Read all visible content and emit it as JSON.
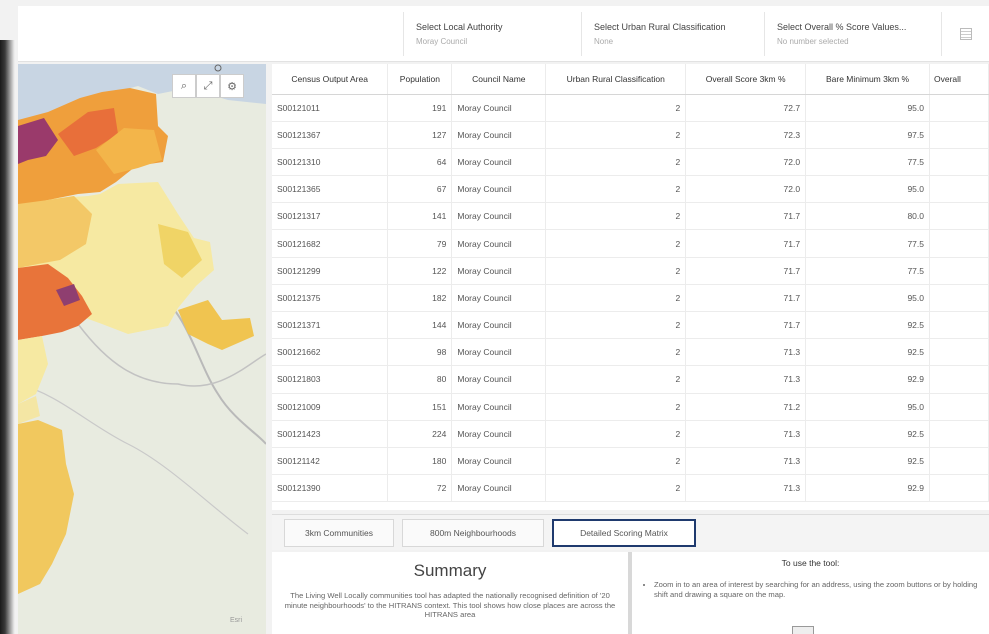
{
  "filters": [
    {
      "label": "Select Local Authority",
      "value": "Moray Council"
    },
    {
      "label": "Select Urban Rural Classification",
      "value": "None"
    },
    {
      "label": "Select Overall % Score Values...",
      "value": "No number selected"
    }
  ],
  "map": {
    "tools": [
      "search-icon",
      "expand-icon",
      "settings-icon"
    ],
    "attribution": "Esri"
  },
  "table": {
    "columns": [
      "Census Output Area",
      "Population",
      "Council Name",
      "Urban Rural Classification",
      "Overall Score 3km %",
      "Bare Minimum 3km %",
      "Overall"
    ],
    "rows": [
      [
        "S00121011",
        "191",
        "Moray Council",
        "2",
        "72.7",
        "95.0",
        ""
      ],
      [
        "S00121367",
        "127",
        "Moray Council",
        "2",
        "72.3",
        "97.5",
        ""
      ],
      [
        "S00121310",
        "64",
        "Moray Council",
        "2",
        "72.0",
        "77.5",
        ""
      ],
      [
        "S00121365",
        "67",
        "Moray Council",
        "2",
        "72.0",
        "95.0",
        ""
      ],
      [
        "S00121317",
        "141",
        "Moray Council",
        "2",
        "71.7",
        "80.0",
        ""
      ],
      [
        "S00121682",
        "79",
        "Moray Council",
        "2",
        "71.7",
        "77.5",
        ""
      ],
      [
        "S00121299",
        "122",
        "Moray Council",
        "2",
        "71.7",
        "77.5",
        ""
      ],
      [
        "S00121375",
        "182",
        "Moray Council",
        "2",
        "71.7",
        "95.0",
        ""
      ],
      [
        "S00121371",
        "144",
        "Moray Council",
        "2",
        "71.7",
        "92.5",
        ""
      ],
      [
        "S00121662",
        "98",
        "Moray Council",
        "2",
        "71.3",
        "92.5",
        ""
      ],
      [
        "S00121803",
        "80",
        "Moray Council",
        "2",
        "71.3",
        "92.9",
        ""
      ],
      [
        "S00121009",
        "151",
        "Moray Council",
        "2",
        "71.2",
        "95.0",
        ""
      ],
      [
        "S00121423",
        "224",
        "Moray Council",
        "2",
        "71.3",
        "92.5",
        ""
      ],
      [
        "S00121142",
        "180",
        "Moray Council",
        "2",
        "71.3",
        "92.5",
        ""
      ],
      [
        "S00121390",
        "72",
        "Moray Council",
        "2",
        "71.3",
        "92.9",
        ""
      ]
    ]
  },
  "tabs": [
    "3km Communities",
    "800m Neighbourhoods",
    "Detailed Scoring Matrix"
  ],
  "summary": {
    "title": "Summary",
    "text": "The Living Well Locally communities tool has adapted the nationally recognised definition of '20 minute neighbourhoods' to the HITRANS context. This tool shows how close places are across the HITRANS area"
  },
  "howto": {
    "title": "To use the tool:",
    "bullet": "Zoom in to an area of interest by searching for an address, using the zoom buttons or by holding shift and drawing a square on the map."
  }
}
